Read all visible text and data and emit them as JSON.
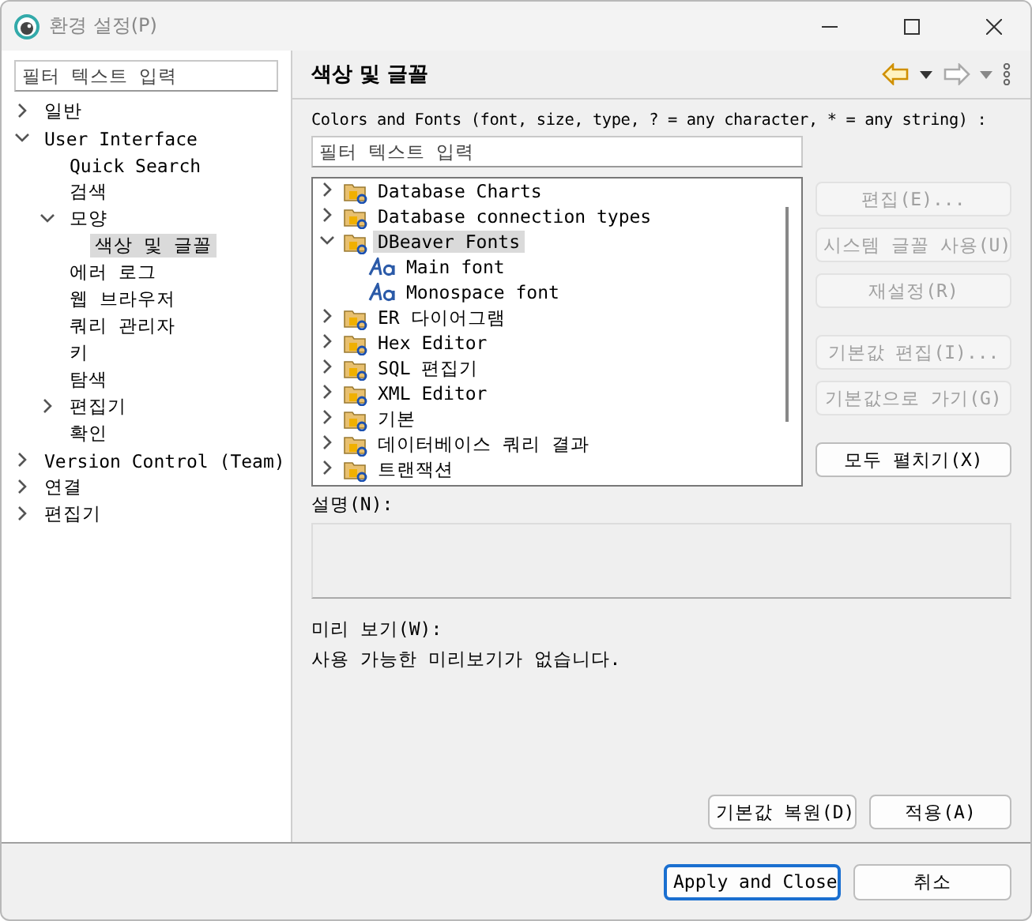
{
  "window": {
    "title": "환경 설정(P)"
  },
  "sidebar": {
    "filter_placeholder": "필터 텍스트 입력",
    "items": [
      {
        "label": "일반",
        "expanded": false,
        "selected": false
      },
      {
        "label": "User Interface",
        "expanded": true,
        "selected": false,
        "children": [
          {
            "label": "Quick Search",
            "selected": false
          },
          {
            "label": "검색",
            "selected": false
          },
          {
            "label": "모양",
            "expanded": true,
            "selected": false,
            "children": [
              {
                "label": "색상 및 글꼴",
                "selected": true
              }
            ]
          },
          {
            "label": "에러 로그",
            "selected": false
          },
          {
            "label": "웹 브라우저",
            "selected": false
          },
          {
            "label": "쿼리 관리자",
            "selected": false
          },
          {
            "label": "키",
            "selected": false
          },
          {
            "label": "탐색",
            "selected": false
          },
          {
            "label": "편집기",
            "expanded": false,
            "selected": false
          },
          {
            "label": "확인",
            "selected": false
          }
        ]
      },
      {
        "label": "Version Control (Team)",
        "expanded": false,
        "selected": false
      },
      {
        "label": "연결",
        "expanded": false,
        "selected": false
      },
      {
        "label": "편집기",
        "expanded": false,
        "selected": false
      }
    ]
  },
  "page": {
    "title": "색상 및 글꼴",
    "description": "Colors and Fonts (font, size, type, ? = any character, * = any string) :",
    "filter_placeholder": "필터 텍스트 입력",
    "tree": [
      {
        "kind": "category",
        "label": "Database Charts",
        "expanded": false,
        "selected": false
      },
      {
        "kind": "category",
        "label": "Database connection types",
        "expanded": false,
        "selected": false
      },
      {
        "kind": "category",
        "label": "DBeaver Fonts",
        "expanded": true,
        "selected": true,
        "children": [
          {
            "kind": "font",
            "label": "Main font",
            "selected": false
          },
          {
            "kind": "font",
            "label": "Monospace font",
            "selected": false
          }
        ]
      },
      {
        "kind": "category",
        "label": "ER 다이어그램",
        "expanded": false,
        "selected": false
      },
      {
        "kind": "category",
        "label": "Hex Editor",
        "expanded": false,
        "selected": false
      },
      {
        "kind": "category",
        "label": "SQL 편집기",
        "expanded": false,
        "selected": false
      },
      {
        "kind": "category",
        "label": "XML Editor",
        "expanded": false,
        "selected": false
      },
      {
        "kind": "category",
        "label": "기본",
        "expanded": false,
        "selected": false
      },
      {
        "kind": "category",
        "label": "데이터베이스 쿼리 결과",
        "expanded": false,
        "selected": false
      },
      {
        "kind": "category",
        "label": "트랜잭션",
        "expanded": false,
        "selected": false
      }
    ],
    "side_buttons": [
      {
        "label": "편집(E)...",
        "disabled": true
      },
      {
        "label": "시스템 글꼴 사용(U)",
        "disabled": true
      },
      {
        "label": "재설정(R)",
        "disabled": true
      },
      {
        "label": "기본값 편집(I)...",
        "disabled": true
      },
      {
        "label": "기본값으로 가기(G)",
        "disabled": true
      },
      {
        "label": "모두 펼치기(X)",
        "disabled": false
      }
    ],
    "description_label": "설명(N):",
    "preview_label": "미리 보기(W):",
    "preview_text": "사용 가능한 미리보기가 없습니다.",
    "buttons": [
      "기본값 복원(D)",
      "적용(A)"
    ]
  },
  "footer": {
    "buttons": [
      {
        "label": "Apply and Close",
        "default": true
      },
      {
        "label": "취소",
        "default": false
      }
    ]
  }
}
